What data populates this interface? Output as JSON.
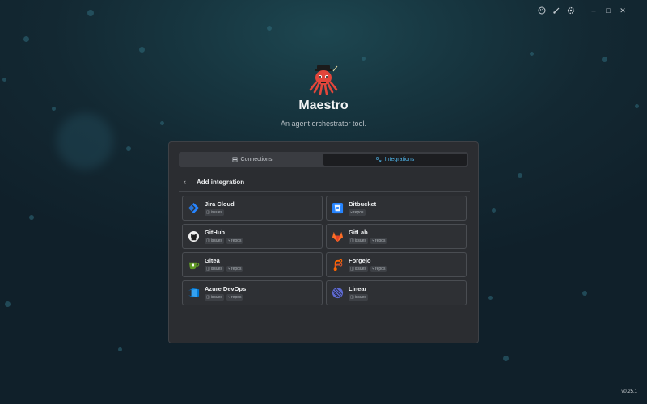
{
  "window": {
    "controls": [
      {
        "name": "palette-icon"
      },
      {
        "name": "brush-icon"
      },
      {
        "name": "settings-icon"
      },
      {
        "name": "minimize-icon",
        "glyph": "–"
      },
      {
        "name": "maximize-icon",
        "glyph": "□"
      },
      {
        "name": "close-icon",
        "glyph": "✕"
      }
    ]
  },
  "app": {
    "title": "Maestro",
    "subtitle": "An agent orchestrator tool.",
    "version": "v0.25.1",
    "logo_icon": "octopus-conductor-logo"
  },
  "tabs": [
    {
      "label": "Connections",
      "icon": "server-icon",
      "active": false
    },
    {
      "label": "Integrations",
      "icon": "integrations-icon",
      "active": true
    }
  ],
  "section": {
    "back_glyph": "‹",
    "title": "Add integration"
  },
  "integrations": [
    {
      "name": "Jira Cloud",
      "icon": "jira-icon",
      "color": "#2684ff",
      "badges": [
        "issues"
      ]
    },
    {
      "name": "Bitbucket",
      "icon": "bitbucket-icon",
      "color": "#2684ff",
      "badges": [
        "repos"
      ]
    },
    {
      "name": "GitHub",
      "icon": "github-icon",
      "color": "#f0f0f0",
      "badges": [
        "issues",
        "repos"
      ]
    },
    {
      "name": "GitLab",
      "icon": "gitlab-icon",
      "color": "#fc6d26",
      "badges": [
        "issues",
        "repos"
      ]
    },
    {
      "name": "Gitea",
      "icon": "gitea-icon",
      "color": "#609926",
      "badges": [
        "issues",
        "repos"
      ]
    },
    {
      "name": "Forgejo",
      "icon": "forgejo-icon",
      "color": "#ff6600",
      "badges": [
        "issues",
        "repos"
      ]
    },
    {
      "name": "Azure DevOps",
      "icon": "azure-devops-icon",
      "color": "#0078d4",
      "badges": [
        "issues",
        "repos"
      ]
    },
    {
      "name": "Linear",
      "icon": "linear-icon",
      "color": "#5e6ad2",
      "badges": [
        "issues"
      ]
    }
  ],
  "colors": {
    "accent": "#4fb3e6",
    "panel": "#2b2d31",
    "background": "#132832"
  }
}
